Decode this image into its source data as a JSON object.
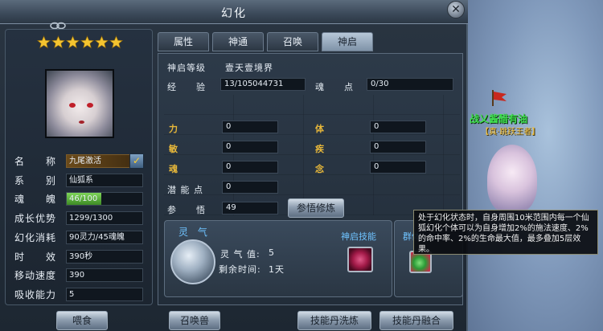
{
  "window": {
    "title": "幻化"
  },
  "tabs": [
    {
      "label": "属性"
    },
    {
      "label": "神通"
    },
    {
      "label": "召唤"
    },
    {
      "label": "神启"
    }
  ],
  "left": {
    "star_count": 6,
    "attributes": [
      {
        "label": "名　　称",
        "value": "九尾激活"
      },
      {
        "label": "系　　别",
        "value": "仙狐系"
      },
      {
        "label": "魂　　魄",
        "value": "46/100",
        "progress": 0.46
      },
      {
        "label": "成长优势",
        "value": "1299/1300"
      },
      {
        "label": "幻化消耗",
        "value": "90灵力/45魂魄"
      },
      {
        "label": "时　　效",
        "value": "390秒"
      },
      {
        "label": "移动速度",
        "value": "390"
      },
      {
        "label": "吸收能力",
        "value": "5"
      }
    ]
  },
  "shenqi": {
    "level_label": "神启等级",
    "level_value": "壹天壹境界",
    "exp_label": "经　　验",
    "exp_value": "13/105044731",
    "soul_label": "魂　　点",
    "soul_value": "0/30",
    "stats": [
      {
        "label": "力",
        "value": "0"
      },
      {
        "label": "体",
        "value": "0"
      },
      {
        "label": "敏",
        "value": "0"
      },
      {
        "label": "疾",
        "value": "0"
      },
      {
        "label": "魂",
        "value": "0"
      },
      {
        "label": "念",
        "value": "0"
      }
    ],
    "potential_label": "潜 能 点",
    "potential_value": "0",
    "insight_label": "参　　悟",
    "insight_value": "49",
    "insight_button": "参悟修炼"
  },
  "spirit": {
    "title": "灵 气",
    "value_label": "灵 气 值:",
    "value": "5",
    "time_label": "剩余时间:",
    "time": "1天",
    "skill_title": "神启技能",
    "group_title": "群体"
  },
  "buttons": {
    "feed": "喂食",
    "summon": "召唤兽",
    "skill_wash": "技能丹洗炼",
    "skill_merge": "技能丹融合"
  },
  "tooltip": {
    "text": "处于幻化状态时，自身周围10米范围内每一个仙狐幻化个体可以为自身增加2%的施法速度、2%的命中率、2%的生命最大值，最多叠加5层效果。"
  },
  "npc": {
    "name": "战乂酱醋有油",
    "title": "【真·跳跃王者】"
  },
  "colors": {
    "accent": "#6fc3ff",
    "gold": "#e8b83a",
    "npc_name": "#40e050"
  }
}
